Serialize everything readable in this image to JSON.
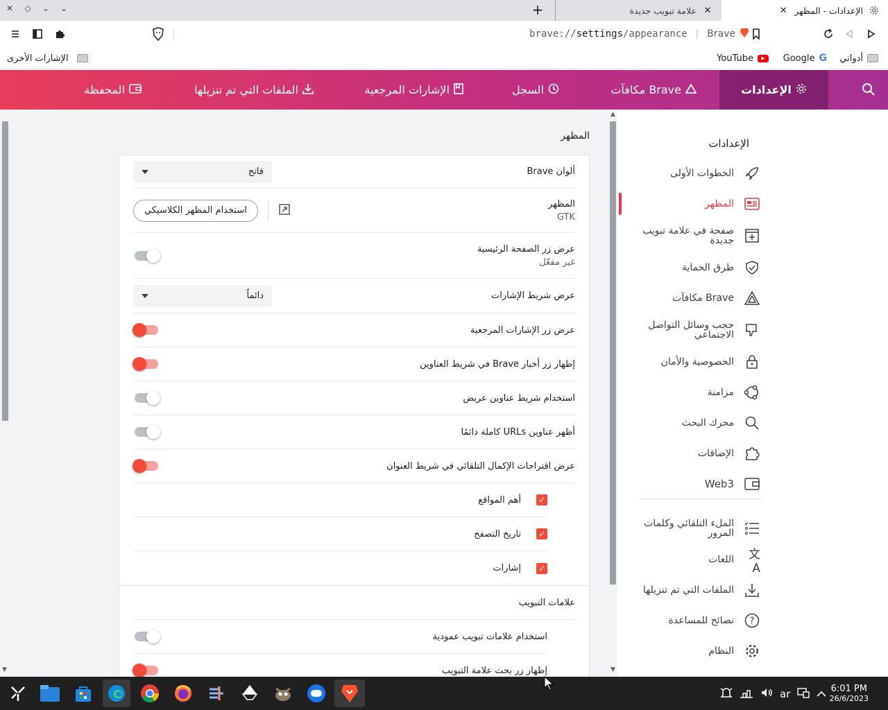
{
  "tabs": {
    "active_title": "الإعدادات - المظهر",
    "new_title": "علامة تبويب جديدة",
    "close_glyph": "✕",
    "new_tab_glyph": "+"
  },
  "toolbar": {
    "url_scheme": "brave://",
    "url_host": "settings",
    "url_path": "/appearance",
    "brand": "Brave"
  },
  "bookmarks": {
    "tools": "أدواتي",
    "google": "Google",
    "youtube": "YouTube",
    "other": "الإشارات الأخرى"
  },
  "header": {
    "settings": "الإعدادات",
    "rewards": "مكافآت Brave",
    "history": "السجل",
    "bookmarks": "الإشارات المرجعية",
    "downloads": "الملفات التي تم تنزيلها",
    "wallet": "المحفظة"
  },
  "sidebar": {
    "title": "الإعدادات",
    "items": [
      {
        "label": "الخطوات الأولى",
        "icon": "rocket-icon"
      },
      {
        "label": "المظهر",
        "icon": "appearance-icon"
      },
      {
        "label": "صفحة في علامة تبويب جديدة",
        "icon": "new-tab-page-icon"
      },
      {
        "label": "طرق الحماية",
        "icon": "shield-icon"
      },
      {
        "label": "مكافآت Brave",
        "icon": "rewards-icon"
      },
      {
        "label": "حجب وسائل التواصل الاجتماعي",
        "icon": "thumbs-down-icon"
      },
      {
        "label": "الخصوصية والأمان",
        "icon": "lock-icon"
      },
      {
        "label": "مزامنة",
        "icon": "sync-icon"
      },
      {
        "label": "محرك البحث",
        "icon": "search-icon"
      },
      {
        "label": "الإضافات",
        "icon": "puzzle-icon"
      },
      {
        "label": "Web3",
        "icon": "wallet-icon"
      },
      {
        "label": "الملء التلقائي وكلمات المرور",
        "icon": "list-icon"
      },
      {
        "label": "اللغات",
        "icon": "language-icon"
      },
      {
        "label": "الملفات التي تم تنزيلها",
        "icon": "download-icon"
      },
      {
        "label": "نصائح للمساعدة",
        "icon": "help-icon"
      },
      {
        "label": "النظام",
        "icon": "gear-icon"
      }
    ]
  },
  "main": {
    "section_title": "المظهر",
    "brave_colors_label": "ألوان Brave",
    "brave_colors_value": "فاتح",
    "theme_label": "المظهر",
    "theme_value": "GTK",
    "classic_button": "استخدام المظهر الكلاسيكي",
    "home_button_label": "عرض زر الصفحة الرئيسية",
    "home_button_sub": "غير مفعّل",
    "bookmarks_bar_label": "عرض شريط الإشارات",
    "bookmarks_bar_value": "دائماً",
    "bookmarks_button_label": "عرض زر الإشارات المرجعية",
    "news_button_label": "إظهار زر أخبار Brave في شريط العناوين",
    "wide_address_label": "استخدام شريط عناوين عريض",
    "full_urls_label": "أظهر عناوين URLs كاملة دائمًا",
    "autocomplete_label": "عرض اقتراحات الإكمال التلقائي في شريط العنوان",
    "top_sites_label": "أهم المواقع",
    "history_label": "تاريخ التصفح",
    "bookmarks_check_label": "إشارات",
    "tabs_heading": "علامات التبويب",
    "vertical_tabs_label": "استخدام علامات تبويب عمودية",
    "tab_search_label": "إظهار زر بحث علامة التبويب"
  },
  "taskbar": {
    "lang": "ar",
    "time": "6:01 PM",
    "date": "26/6/2023"
  },
  "colors": {
    "accent": "#f34a3a",
    "header_start": "#e83d5a",
    "header_end": "#a52f91"
  }
}
